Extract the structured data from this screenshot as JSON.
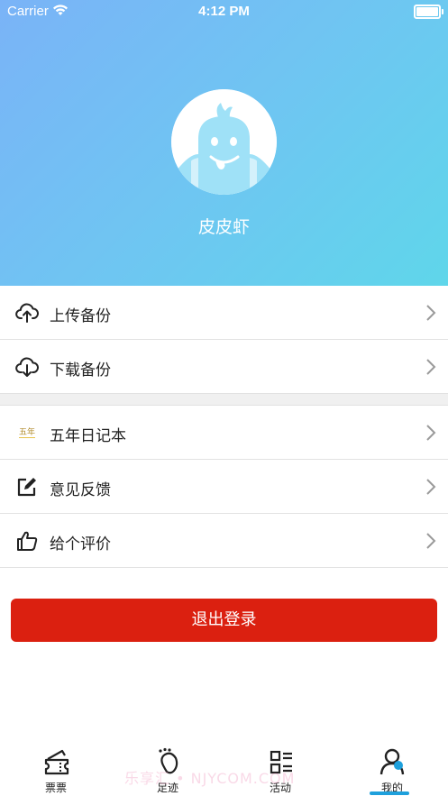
{
  "status_bar": {
    "carrier": "Carrier",
    "time": "4:12 PM"
  },
  "profile": {
    "username": "皮皮虾"
  },
  "menu_group_1": [
    {
      "label": "上传备份",
      "icon": "cloud-upload-icon"
    },
    {
      "label": "下载备份",
      "icon": "cloud-download-icon"
    }
  ],
  "menu_group_2": [
    {
      "label": "五年日记本",
      "icon": "five-year-diary-icon",
      "icon_text": "五年"
    },
    {
      "label": "意见反馈",
      "icon": "edit-feedback-icon"
    },
    {
      "label": "给个评价",
      "icon": "thumbs-up-icon"
    }
  ],
  "logout_label": "退出登录",
  "tabs": [
    {
      "label": "票票",
      "icon": "ticket-icon",
      "active": false
    },
    {
      "label": "足迹",
      "icon": "footprint-icon",
      "active": false
    },
    {
      "label": "活动",
      "icon": "activity-list-icon",
      "active": false
    },
    {
      "label": "我的",
      "icon": "profile-icon",
      "active": true
    }
  ],
  "watermark": "乐享汇 • NJYCOM.COM",
  "colors": {
    "header_gradient_start": "#7ab3f7",
    "header_gradient_end": "#5fd6ea",
    "logout_red": "#db2010",
    "active_tab_blue": "#1ea0dc"
  }
}
